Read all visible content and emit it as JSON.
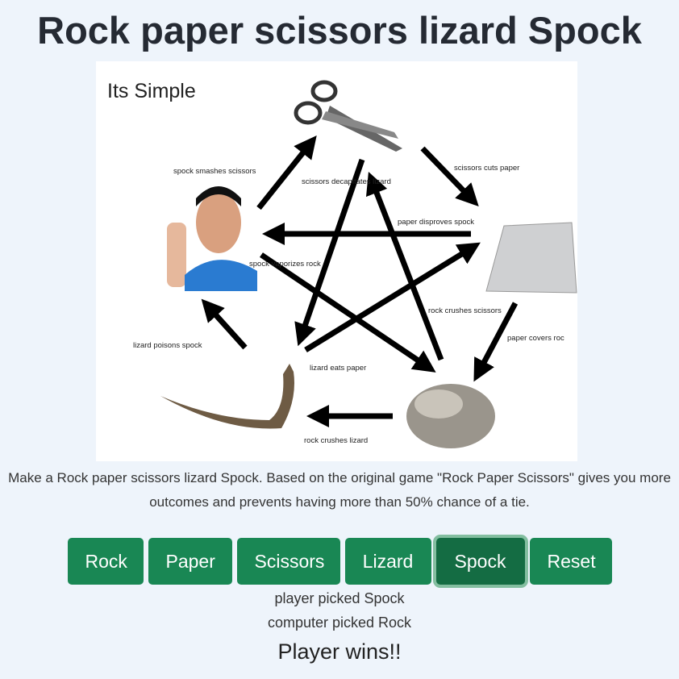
{
  "page": {
    "title": "Rock paper scissors lizard Spock"
  },
  "diagram": {
    "heading": "Its Simple",
    "rules": [
      "spock smashes scissors",
      "scissors cuts paper",
      "scissors decapitates lizard",
      "paper disproves spock",
      "spock vaporizes rock",
      "rock crushes scissors",
      "paper covers roc",
      "lizard poisons spock",
      "lizard eats paper",
      "rock crushes lizard"
    ]
  },
  "description": "Make a Rock paper scissors lizard Spock. Based on the original game \"Rock Paper Scissors\" gives you more outcomes and prevents having more than 50% chance of a tie.",
  "controls": {
    "rock": "Rock",
    "paper": "Paper",
    "scissors": "Scissors",
    "lizard": "Lizard",
    "spock": "Spock",
    "reset": "Reset"
  },
  "status": {
    "player": "player picked Spock",
    "computer": "computer picked Rock",
    "result": "Player wins!!"
  },
  "colors": {
    "button": "#198754",
    "button_active": "#146c43",
    "background": "#eef4fb"
  }
}
